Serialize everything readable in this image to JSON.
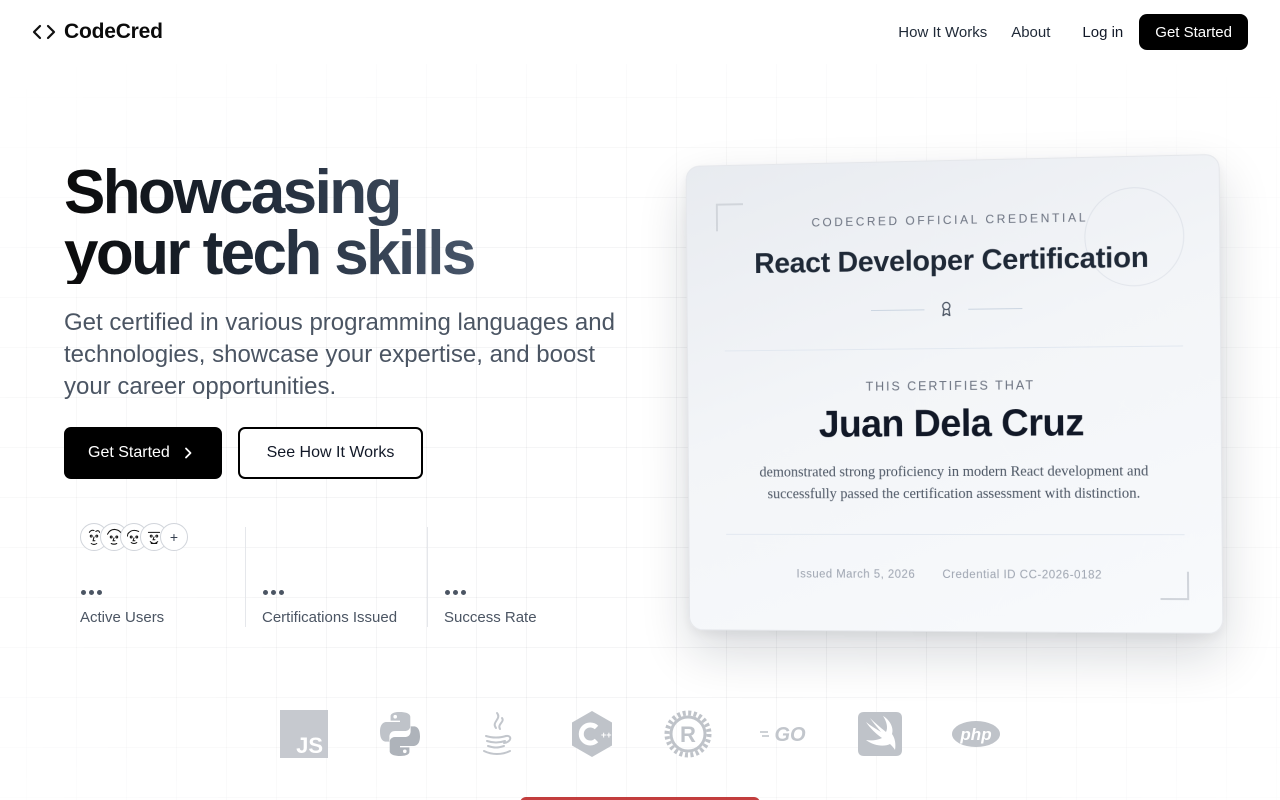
{
  "brand": {
    "name": "CodeCred",
    "icon": "code-brackets-icon"
  },
  "nav": {
    "links": [
      "How It Works",
      "About"
    ],
    "login": "Log in",
    "cta": "Get Started"
  },
  "hero": {
    "title_line1": "Showcasing",
    "title_line2": "your tech skills",
    "subtitle": "Get certified in various programming languages and technologies, showcase your expertise, and boost your career opportunities.",
    "primary_button": "Get Started",
    "secondary_button": "See How It Works"
  },
  "stats": {
    "avatars_more": "+",
    "items": [
      {
        "label": "Active Users"
      },
      {
        "label": "Certifications Issued"
      },
      {
        "label": "Success Rate"
      }
    ]
  },
  "certificate": {
    "overline": "CODECRED OFFICIAL CREDENTIAL",
    "title": "React Developer Certification",
    "certifies": "THIS CERTIFIES THAT",
    "name": "Juan Dela Cruz",
    "description": "demonstrated strong proficiency in modern React development and successfully passed the certification assessment with distinction.",
    "issued": "Issued March 5, 2026",
    "credential_id": "Credential ID CC-2026-0182"
  },
  "logos": [
    {
      "name": "javascript-logo",
      "text": "JS"
    },
    {
      "name": "python-logo"
    },
    {
      "name": "java-logo"
    },
    {
      "name": "cpp-logo"
    },
    {
      "name": "rust-logo"
    },
    {
      "name": "go-logo",
      "text": "GO"
    },
    {
      "name": "swift-logo"
    },
    {
      "name": "php-logo",
      "text": "php"
    }
  ],
  "colors": {
    "primary": "#000000",
    "text": "#111827",
    "muted": "#4b5563",
    "logo_gray": "#9ca3af"
  }
}
